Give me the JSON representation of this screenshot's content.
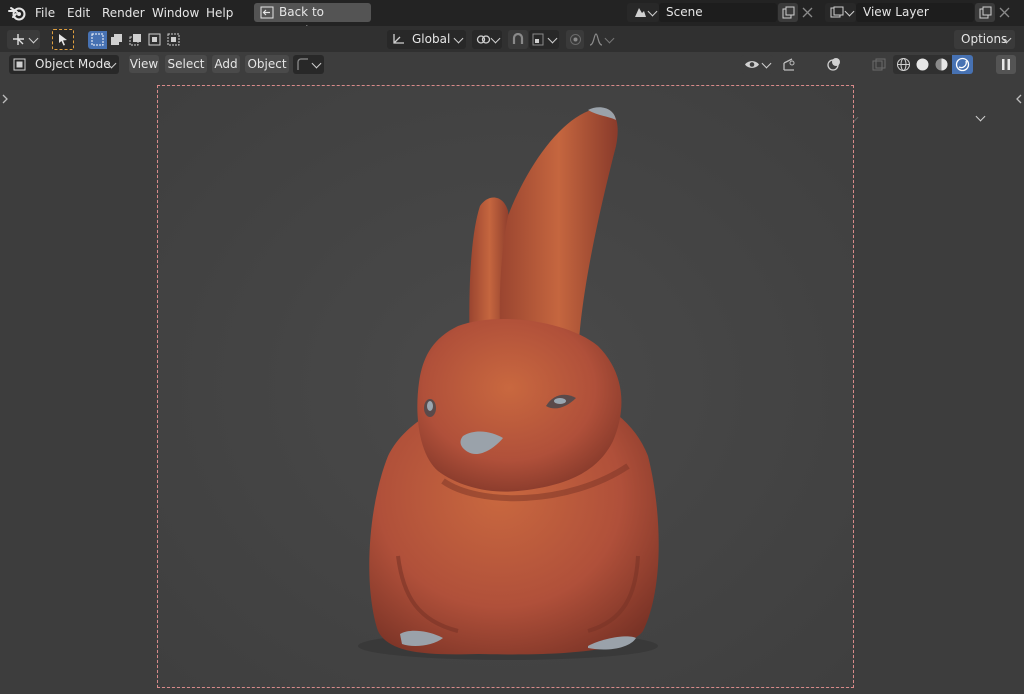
{
  "topbar": {
    "menus": [
      "File",
      "Edit",
      "Render",
      "Window",
      "Help"
    ],
    "back_button": "Back to Previous",
    "scene": {
      "value": "Scene"
    },
    "view_layer": {
      "value": "View Layer"
    }
  },
  "tool_header": {
    "transform_orientation": "Global",
    "options_label": "Options"
  },
  "viewport_header": {
    "mode": "Object Mode",
    "menus": [
      "View",
      "Select",
      "Add",
      "Object"
    ]
  },
  "colors": {
    "accent": "#4772b3",
    "background": "#3d3d3d",
    "camera_frame": "#d98a8a",
    "object": "#b5553a"
  },
  "icons": [
    "blender-logo-icon",
    "back-arrow-icon",
    "scene-icon",
    "copy-icon",
    "close-icon",
    "view-layer-icon",
    "transform-icon",
    "select-box-icon",
    "orientation-icon",
    "pivot-icon",
    "snap-icon",
    "proportional-icon",
    "object-mode-icon",
    "visibility-icon",
    "gizmo-icon",
    "overlay-icon",
    "xray-icon",
    "wireframe-icon",
    "solid-icon",
    "material-icon",
    "rendered-icon",
    "pause-icon",
    "collapse-arrow-icon"
  ]
}
